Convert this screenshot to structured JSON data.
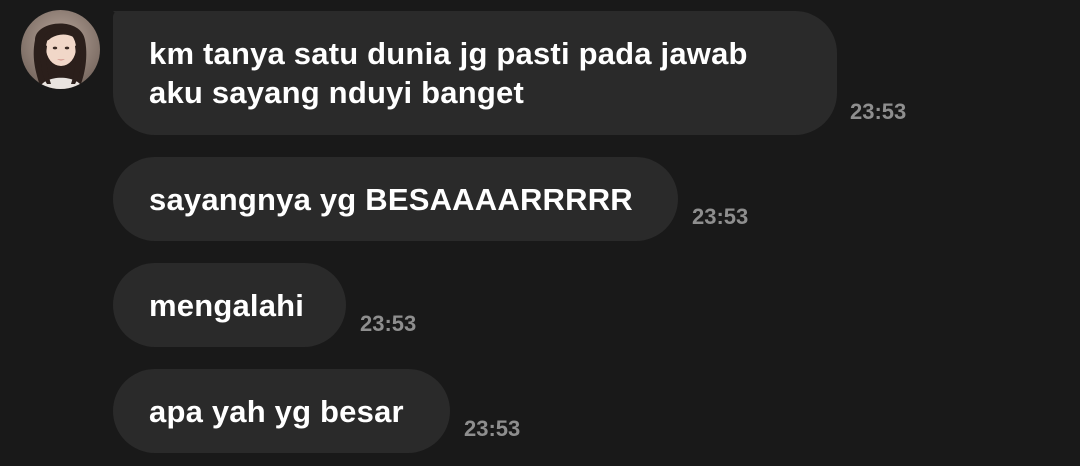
{
  "conversation": {
    "contact": {
      "avatar_icon": "profile-photo-avatar"
    },
    "messages": [
      {
        "text": "km tanya satu dunia jg pasti pada jawab\naku sayang nduyi banget",
        "time": "23:53"
      },
      {
        "text": "sayangnya yg BESAAAARRRRR",
        "time": "23:53"
      },
      {
        "text": "mengalahi",
        "time": "23:53"
      },
      {
        "text": "apa yah yg besar",
        "time": "23:53"
      }
    ]
  },
  "colors": {
    "background": "#191919",
    "bubble": "#2a2a2a",
    "text": "#ffffff",
    "timestamp": "#8e8e8e"
  }
}
